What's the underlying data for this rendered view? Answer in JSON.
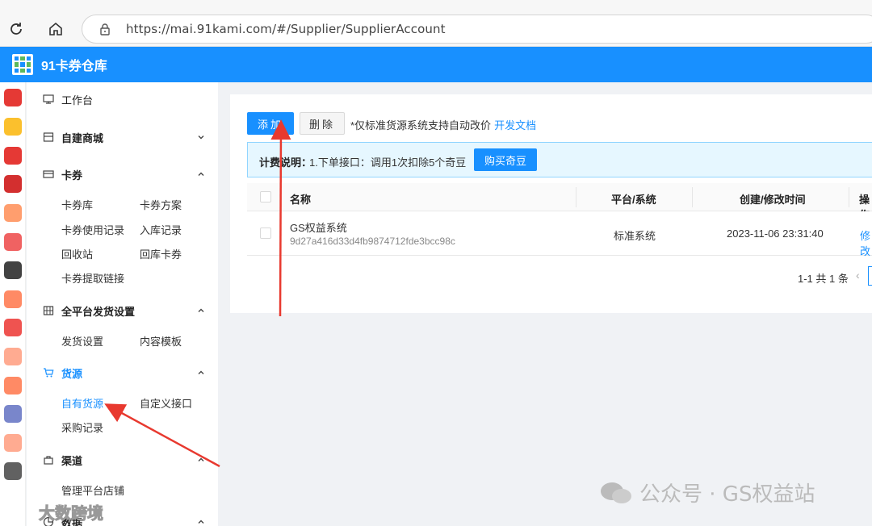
{
  "browser": {
    "url": "https://mai.91kami.com/#/Supplier/SupplierAccount"
  },
  "app": {
    "title": "91卡券仓库"
  },
  "sidebar": {
    "workbench": "工作台",
    "self_mall": "自建商城",
    "card": "卡券",
    "card_items": [
      "卡券库",
      "卡券方案",
      "卡券使用记录",
      "入库记录",
      "回收站",
      "回库卡券",
      "卡券提取链接"
    ],
    "delivery": "全平台发货设置",
    "delivery_items": [
      "发货设置",
      "内容模板"
    ],
    "supply": "货源",
    "supply_items": [
      "自有货源",
      "自定义接口",
      "采购记录"
    ],
    "channel": "渠道",
    "channel_items": [
      "管理平台店铺"
    ],
    "data": "数据"
  },
  "toolbar": {
    "add_label": "添加",
    "delete_label": "删除",
    "note": "*仅标准货源系统支持自动改价",
    "doc_link": "开发文档"
  },
  "billing": {
    "label": "计费说明：",
    "text": "1.下单接口：调用1次扣除5个奇豆",
    "buy_label": "购买奇豆"
  },
  "table": {
    "headers": [
      "名称",
      "平台/系统",
      "创建/修改时间",
      "操作"
    ],
    "rows": [
      {
        "name": "GS权益系统",
        "key": "9d27a416d33d4fb9874712fde3bcc98c",
        "platform": "标准系统",
        "time": "2023-11-06 23:31:40",
        "action": "修改"
      }
    ]
  },
  "pagination": {
    "summary": "1-1 共 1 条"
  },
  "watermarks": {
    "right": "公众号 · GS权益站",
    "left": "大数跨境"
  },
  "colors": {
    "primary": "#1890ff",
    "annotation_arrow": "#e8392f"
  }
}
